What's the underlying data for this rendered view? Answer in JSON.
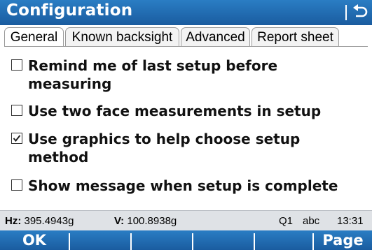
{
  "window": {
    "title": "Configuration"
  },
  "tabs": [
    {
      "label": "General",
      "active": true
    },
    {
      "label": "Known backsight",
      "active": false
    },
    {
      "label": "Advanced",
      "active": false
    },
    {
      "label": "Report sheet",
      "active": false
    }
  ],
  "options": [
    {
      "label": "Remind me of last setup before measuring",
      "checked": false
    },
    {
      "label": "Use two face measurements in setup",
      "checked": false
    },
    {
      "label": "Use graphics to help choose setup method",
      "checked": true
    },
    {
      "label": "Show message when setup is complete",
      "checked": false
    }
  ],
  "status": {
    "hz_label": "Hz:",
    "hz_value": "395.4943g",
    "v_label": "V:",
    "v_value": "100.8938g",
    "quality": "Q1",
    "input_mode": "abc",
    "time": "13:31"
  },
  "softkeys": {
    "ok": "OK",
    "page": "Page"
  },
  "colors": {
    "bar_blue": "#1f6bb0",
    "status_bg": "#dfe2e6"
  },
  "icons": {
    "back": "return-arrow-icon",
    "checkbox": "checkbox-icon"
  }
}
